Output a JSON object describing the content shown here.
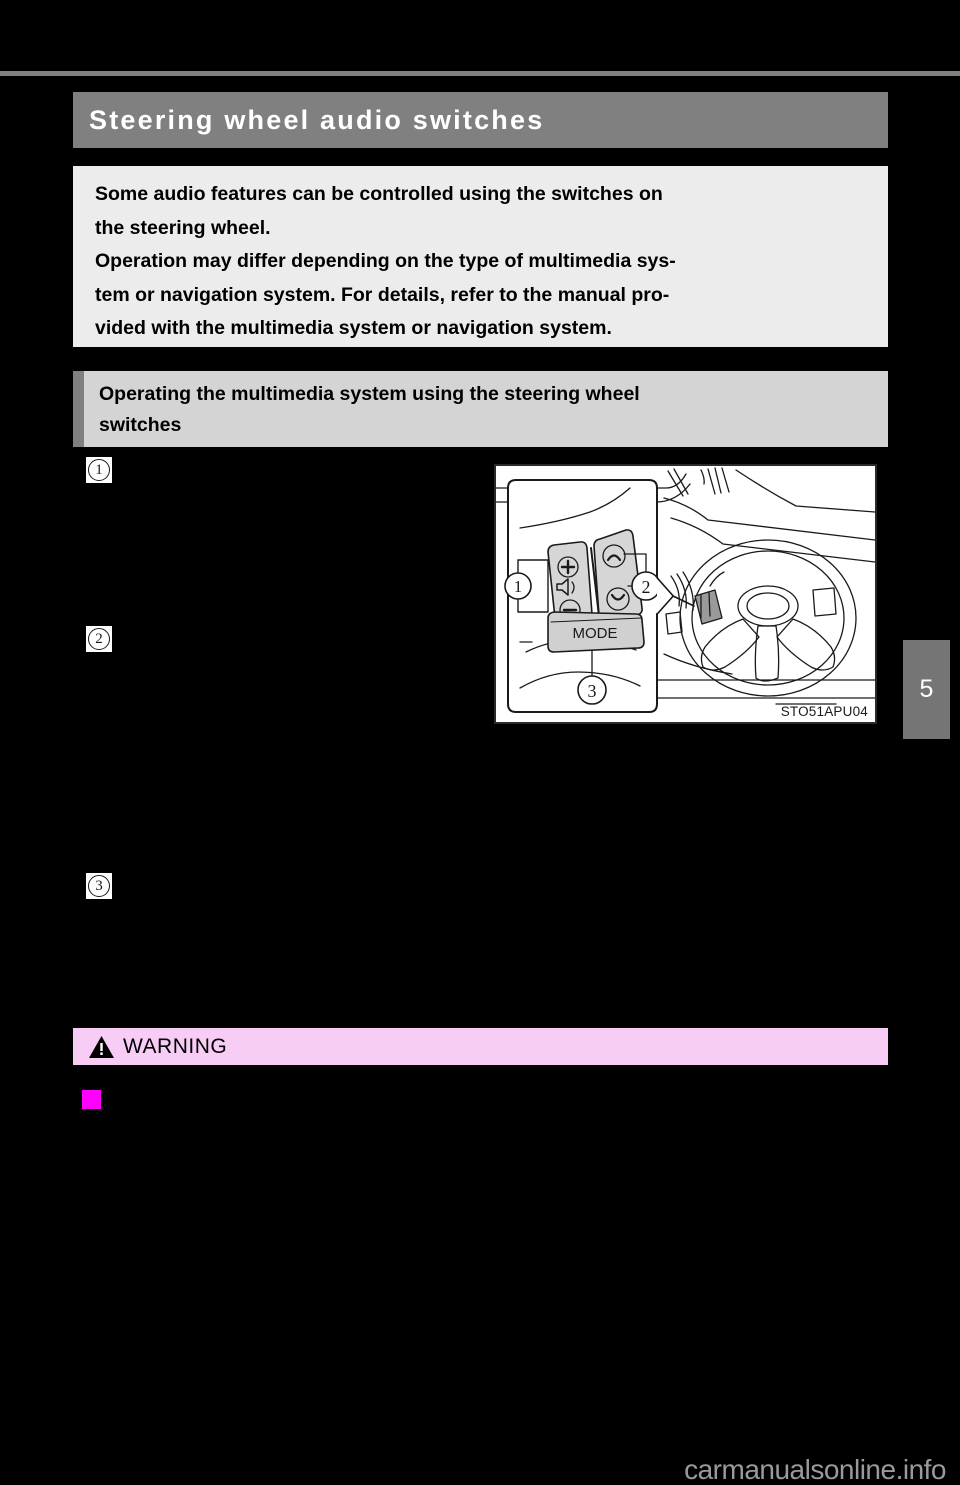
{
  "page": {
    "background_color": "#000000",
    "chapter_tab_number": "5",
    "watermark": "carmanualsonline.info"
  },
  "header": {
    "title": "Steering wheel audio switches",
    "banner_color": "#808080",
    "text_color": "#ffffff"
  },
  "intro": {
    "background_color": "#ececec",
    "lines": [
      "Some audio features can be controlled using the switches on",
      "the steering wheel.",
      "Operation may differ depending on the type of multimedia sys-",
      "tem or navigation system. For details, refer to the manual pro-",
      "vided with the multimedia system or navigation system."
    ]
  },
  "subsection": {
    "background_color": "#d4d4d4",
    "accent_color": "#808080",
    "lines": [
      "Operating the multimedia system using the steering wheel",
      "switches"
    ]
  },
  "callouts": [
    {
      "number": "1",
      "icon": "circled-number-1-icon"
    },
    {
      "number": "2",
      "icon": "circled-number-2-icon"
    },
    {
      "number": "3",
      "icon": "circled-number-3-icon"
    }
  ],
  "illustration": {
    "code": "STO51APU04",
    "alt": "Steering wheel with audio control switches, detail callout view",
    "labels": [
      "1",
      "2",
      "3"
    ],
    "mode_button_label": "MODE",
    "icons": [
      "volume-up-icon",
      "volume-down-icon",
      "speaker-icon",
      "seek-up-icon",
      "seek-down-icon",
      "mode-button-icon"
    ]
  },
  "warning": {
    "label": "WARNING",
    "icon": "warning-triangle-icon",
    "background_color": "#f7cdf5",
    "bullet_color": "#ff00ff"
  }
}
